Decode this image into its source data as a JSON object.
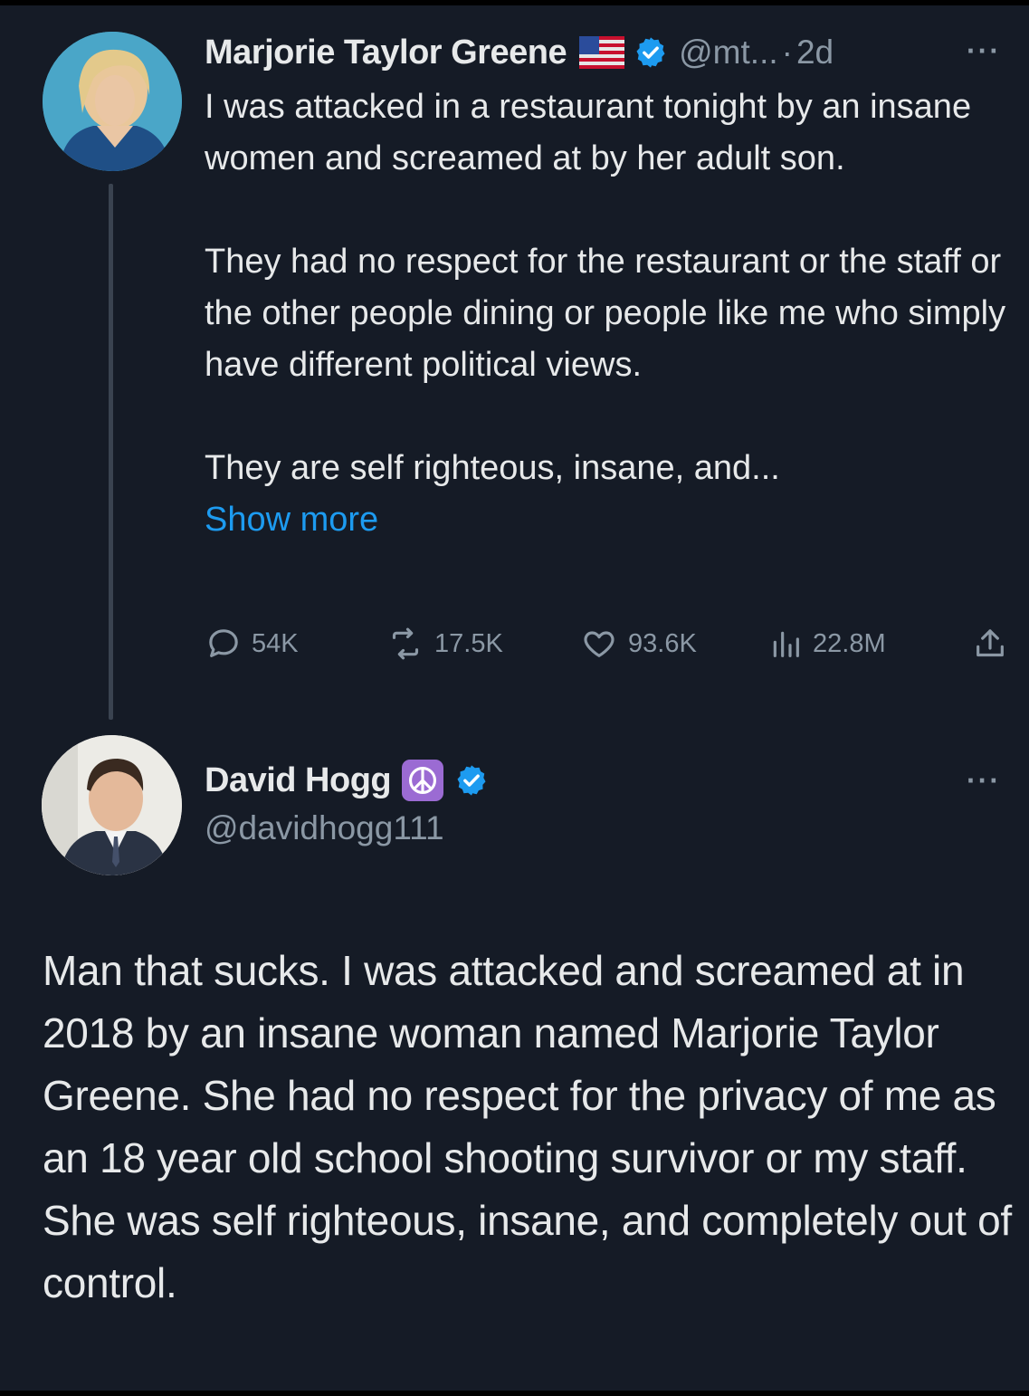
{
  "tweet1": {
    "author_name": "Marjorie Taylor Greene",
    "flag_icon": "us-flag-icon",
    "verified_icon": "verified-badge-icon",
    "handle": "@mt...",
    "separator": "·",
    "time": "2d",
    "more_label": "···",
    "paragraphs": [
      "I was attacked in a restaurant tonight by an insane women and screamed at by her adult son.",
      "They had no respect for the restaurant or the staff or the other people dining or people like me who simply have different political views.",
      "They are self righteous, insane, and..."
    ],
    "show_more": "Show more",
    "stats": {
      "replies": "54K",
      "reposts": "17.5K",
      "likes": "93.6K",
      "views": "22.8M"
    }
  },
  "tweet2": {
    "author_name": "David Hogg",
    "emoji_icon": "peace-symbol-icon",
    "verified_icon": "verified-badge-icon",
    "handle": "@davidhogg111",
    "more_label": "···",
    "paragraphs": [
      "Man that sucks. I was attacked and screamed at in 2018 by an insane woman named Marjorie Taylor Greene. She had no respect for the privacy of me as an 18 year old school shooting survivor or my staff.",
      "She was self righteous, insane, and completely out of control."
    ]
  },
  "colors": {
    "background": "#151b26",
    "text": "#e7e9ea",
    "secondary": "#8b98a5",
    "accent": "#1d9bf0",
    "verified": "#1d9bf0",
    "peace_bg": "#9b6bd3"
  }
}
